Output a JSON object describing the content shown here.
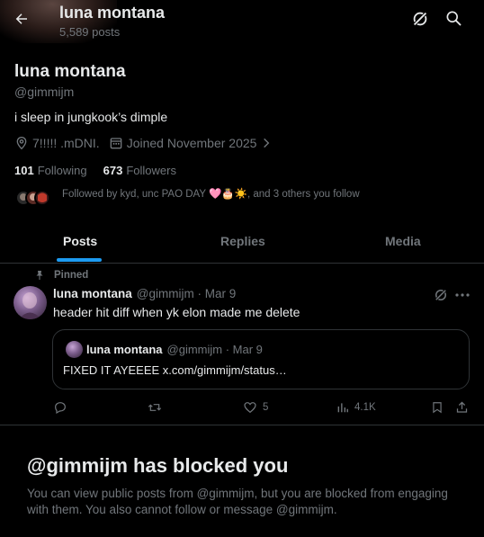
{
  "header": {
    "title": "luna montana",
    "post_count": "5,589 posts"
  },
  "profile": {
    "name": "luna montana",
    "handle": "@gimmijm",
    "bio": "i sleep in jungkook’s dimple",
    "location": "7!!!!! .mDNI.",
    "joined": "Joined November 2025",
    "following_count": "101",
    "following_label": "Following",
    "followers_count": "673",
    "followers_label": "Followers",
    "followed_by_prefix": "Followed by kyd, unc PAO DAY",
    "followed_by_emoji": "🩷🎂☀️",
    "followed_by_suffix": ", and 3 others you follow"
  },
  "tabs": [
    {
      "label": "Posts",
      "active": true
    },
    {
      "label": "Replies",
      "active": false
    },
    {
      "label": "Media",
      "active": false
    }
  ],
  "post": {
    "pinned_label": "Pinned",
    "author": "luna montana",
    "meta": "@gimmijm · Mar 9",
    "text": "header hit diff when yk elon made me delete",
    "quote": {
      "author": "luna montana",
      "meta": "@gimmijm · Mar 9",
      "text": "FIXED IT AYEEEE x.com/gimmijm/status…"
    },
    "actions": {
      "replies": "",
      "reposts": "",
      "likes": "5",
      "views": "4.1K"
    }
  },
  "blocked": {
    "title": "@gimmijm has blocked you",
    "text": "You can view public posts from @gimmijm, but you are blocked from engaging with them. You also cannot follow or message @gimmijm."
  },
  "colors": {
    "background": "#000000",
    "text": "#e7e9ea",
    "muted": "#71767b",
    "accent": "#1d9bf0",
    "border": "#2f3336"
  }
}
